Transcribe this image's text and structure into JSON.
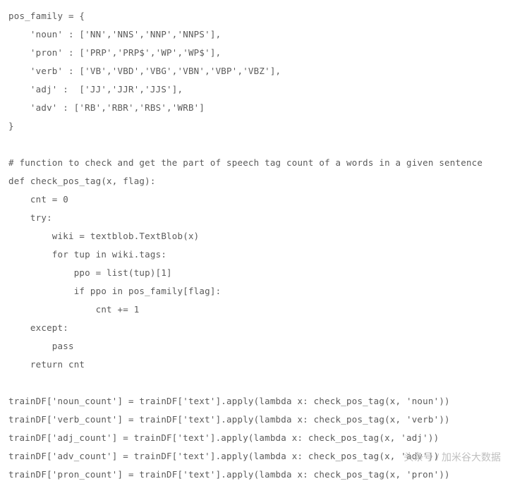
{
  "code": {
    "lines": [
      "pos_family = {",
      "    'noun' : ['NN','NNS','NNP','NNPS'],",
      "    'pron' : ['PRP','PRP$','WP','WP$'],",
      "    'verb' : ['VB','VBD','VBG','VBN','VBP','VBZ'],",
      "    'adj' :  ['JJ','JJR','JJS'],",
      "    'adv' : ['RB','RBR','RBS','WRB']",
      "}",
      "",
      "# function to check and get the part of speech tag count of a words in a given sentence",
      "def check_pos_tag(x, flag):",
      "    cnt = 0",
      "    try:",
      "        wiki = textblob.TextBlob(x)",
      "        for tup in wiki.tags:",
      "            ppo = list(tup)[1]",
      "            if ppo in pos_family[flag]:",
      "                cnt += 1",
      "    except:",
      "        pass",
      "    return cnt",
      "",
      "trainDF['noun_count'] = trainDF['text'].apply(lambda x: check_pos_tag(x, 'noun'))",
      "trainDF['verb_count'] = trainDF['text'].apply(lambda x: check_pos_tag(x, 'verb'))",
      "trainDF['adj_count'] = trainDF['text'].apply(lambda x: check_pos_tag(x, 'adj'))",
      "trainDF['adv_count'] = trainDF['text'].apply(lambda x: check_pos_tag(x, 'adv'))",
      "trainDF['pron_count'] = trainDF['text'].apply(lambda x: check_pos_tag(x, 'pron'))"
    ]
  },
  "watermark": "头条号 / 加米谷大数据"
}
